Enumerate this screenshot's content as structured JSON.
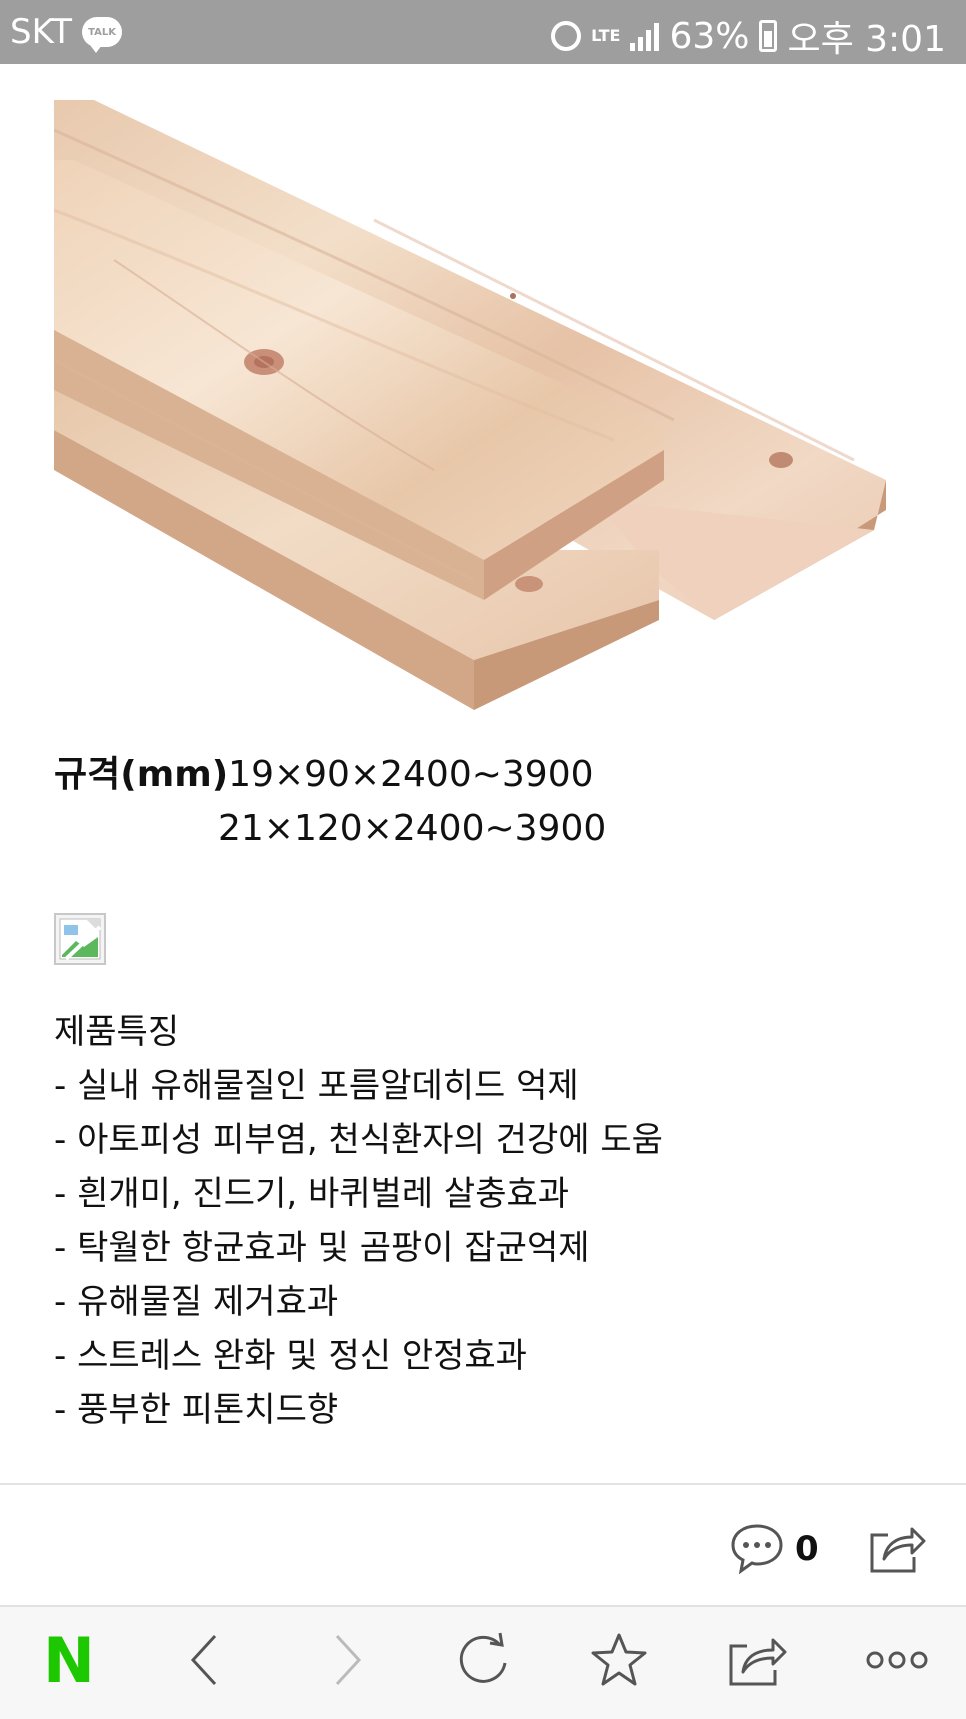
{
  "status_bar": {
    "carrier": "SKT",
    "talk_badge": "TALK",
    "network": "LTE",
    "battery": "63%",
    "time": "오후 3:01"
  },
  "spec": {
    "label": "규격(mm)",
    "line1": "19×90×2400~3900",
    "line2": "21×120×2400~3900"
  },
  "features": {
    "title": "제품특징",
    "items": [
      "- 실내 유해물질인 포름알데히드 억제",
      "- 아토피성 피부염, 천식환자의 건강에 도움",
      "- 흰개미, 진드기, 바퀴벌레 살충효과",
      "- 탁월한 항균효과 및 곰팡이 잡균억제",
      "- 유해물질 제거효과",
      "- 스트레스 완화 및 정신 안정효과",
      "- 풍부한 피톤치드향"
    ]
  },
  "actions": {
    "comment_count": "0"
  },
  "bottom_nav": {
    "logo": "N",
    "logo_color": "#1ec800"
  },
  "icons": [
    "alarm-icon",
    "signal-icon",
    "battery-icon",
    "comment-icon",
    "share-icon",
    "back-icon",
    "forward-icon",
    "refresh-icon",
    "bookmark-star-icon",
    "more-icon",
    "broken-image-icon"
  ]
}
